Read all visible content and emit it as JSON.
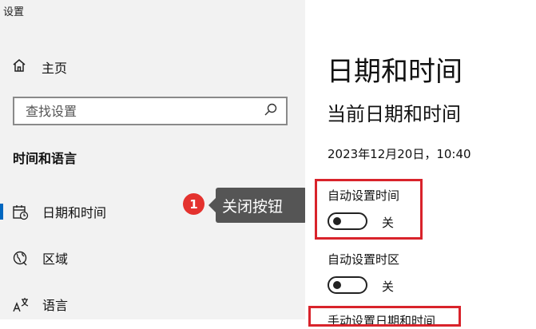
{
  "window": {
    "title": "设置"
  },
  "sidebar": {
    "home_label": "主页",
    "search_placeholder": "查找设置",
    "section_title": "时间和语言",
    "items": [
      {
        "label": "日期和时间",
        "icon": "calendar-clock-icon",
        "selected": true
      },
      {
        "label": "区域",
        "icon": "globe-icon",
        "selected": false
      },
      {
        "label": "语言",
        "icon": "language-icon",
        "selected": false
      }
    ]
  },
  "annotation": {
    "step": "1",
    "tooltip": "关闭按钮"
  },
  "main": {
    "title": "日期和时间",
    "subtitle": "当前日期和时间",
    "current_datetime": "2023年12月20日，10:40",
    "settings": [
      {
        "label": "自动设置时间",
        "state": "关"
      },
      {
        "label": "自动设置时区",
        "state": "关"
      }
    ],
    "next_setting_partial": "手动设置日期和时间"
  },
  "colors": {
    "accent": "#0067c0",
    "highlight_red": "#d9232b",
    "badge_red": "#e4322e",
    "tooltip_bg": "#555555"
  }
}
